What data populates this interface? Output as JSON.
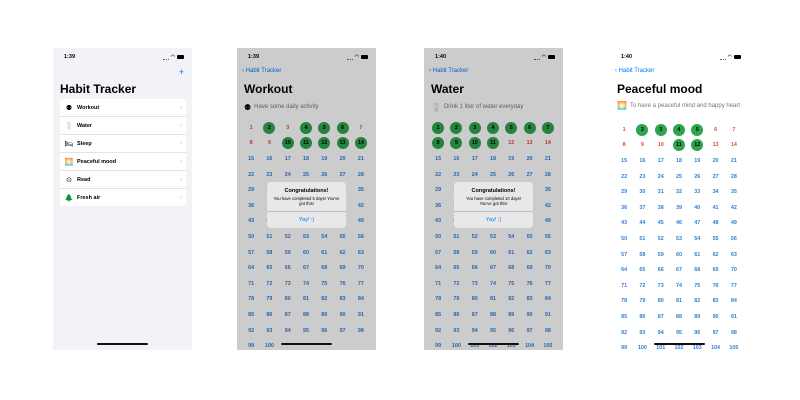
{
  "screens": [
    {
      "time": "1:39",
      "title": "Habit Tracker",
      "add_label": "+",
      "habits": [
        {
          "label": "Workout",
          "icon": "dumbbell-icon",
          "glyph": "⚉"
        },
        {
          "label": "Water",
          "icon": "glass-icon",
          "glyph": "🥛"
        },
        {
          "label": "Sleep",
          "icon": "bed-icon",
          "glyph": "🛏"
        },
        {
          "label": "Peaceful mood",
          "icon": "sunrise-icon",
          "glyph": "🌅"
        },
        {
          "label": "Read",
          "icon": "book-icon",
          "glyph": "⊙"
        },
        {
          "label": "Fresh air",
          "icon": "tree-icon",
          "glyph": "🌲"
        }
      ]
    },
    {
      "time": "1:39",
      "back_label": "Habit Tracker",
      "title": "Workout",
      "description": "Have some daily activity",
      "icon": "dumbbell-icon",
      "glyph": "⚉",
      "day_count": 100,
      "completed_days": [
        2,
        4,
        5,
        6,
        10,
        11,
        12,
        13,
        14
      ],
      "missed_days": [
        1,
        3,
        7,
        8,
        9
      ],
      "alert": {
        "title": "Congratulations!",
        "message": "You have completed 5 days! You've got this!",
        "button": "Yay! :)"
      }
    },
    {
      "time": "1:40",
      "back_label": "Habit Tracker",
      "title": "Water",
      "description": "Drink 1 liter of water everyday",
      "icon": "glass-icon",
      "glyph": "🥛",
      "day_count": 112,
      "completed_days": [
        1,
        2,
        3,
        4,
        5,
        6,
        7,
        8,
        9,
        10,
        11
      ],
      "missed_days": [
        12,
        13,
        14
      ],
      "alert": {
        "title": "Congratulations!",
        "message": "You have completed 10 days! You've got this!",
        "button": "Yay! :)"
      }
    },
    {
      "time": "1:40",
      "back_label": "Habit Tracker",
      "title": "Peaceful mood",
      "description": "To have a peaceful mind and happy heart",
      "icon": "sunrise-icon",
      "glyph": "🌅",
      "day_count": 112,
      "completed_days": [
        2,
        3,
        4,
        5,
        11,
        12
      ],
      "missed_days": [
        1,
        6,
        7,
        8,
        9,
        10,
        13,
        14
      ]
    }
  ],
  "colors": {
    "completed": "#2da44e",
    "missed": "#e5473a",
    "pending": "#2f7fd6",
    "accent": "#007aff"
  }
}
